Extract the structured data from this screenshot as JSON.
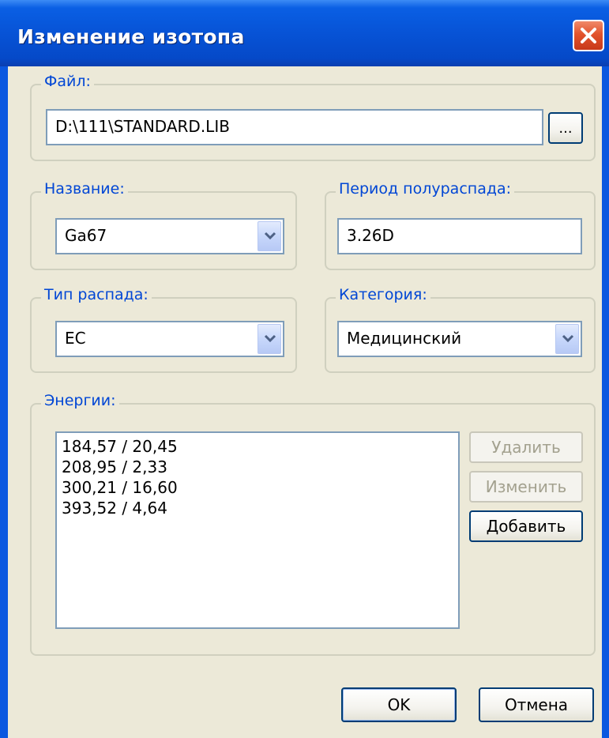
{
  "window": {
    "title": "Изменение изотопа"
  },
  "file": {
    "legend": "Файл:",
    "path": "D:\\111\\STANDARD.LIB",
    "browse_label": "..."
  },
  "name": {
    "legend": "Название:",
    "value": "Ga67"
  },
  "half_life": {
    "legend": "Период полураспада:",
    "value": "3.26D"
  },
  "decay_type": {
    "legend": "Тип распада:",
    "value": "EC"
  },
  "category": {
    "legend": "Категория:",
    "value": "Медицинский"
  },
  "energies": {
    "legend": "Энергии:",
    "items": [
      "184,57 / 20,45",
      "208,95 / 2,33",
      "300,21 / 16,60",
      "393,52 / 4,64"
    ],
    "delete_label": "Удалить",
    "edit_label": "Изменить",
    "add_label": "Добавить"
  },
  "footer": {
    "ok_label": "OK",
    "cancel_label": "Отмена"
  },
  "colors": {
    "titlebar": "#0753d6",
    "client_bg": "#ece9d8",
    "legend_text": "#0046d5",
    "close_button": "#e2532c"
  },
  "icons": {
    "close": "close-icon",
    "dropdown": "chevron-down-icon"
  }
}
